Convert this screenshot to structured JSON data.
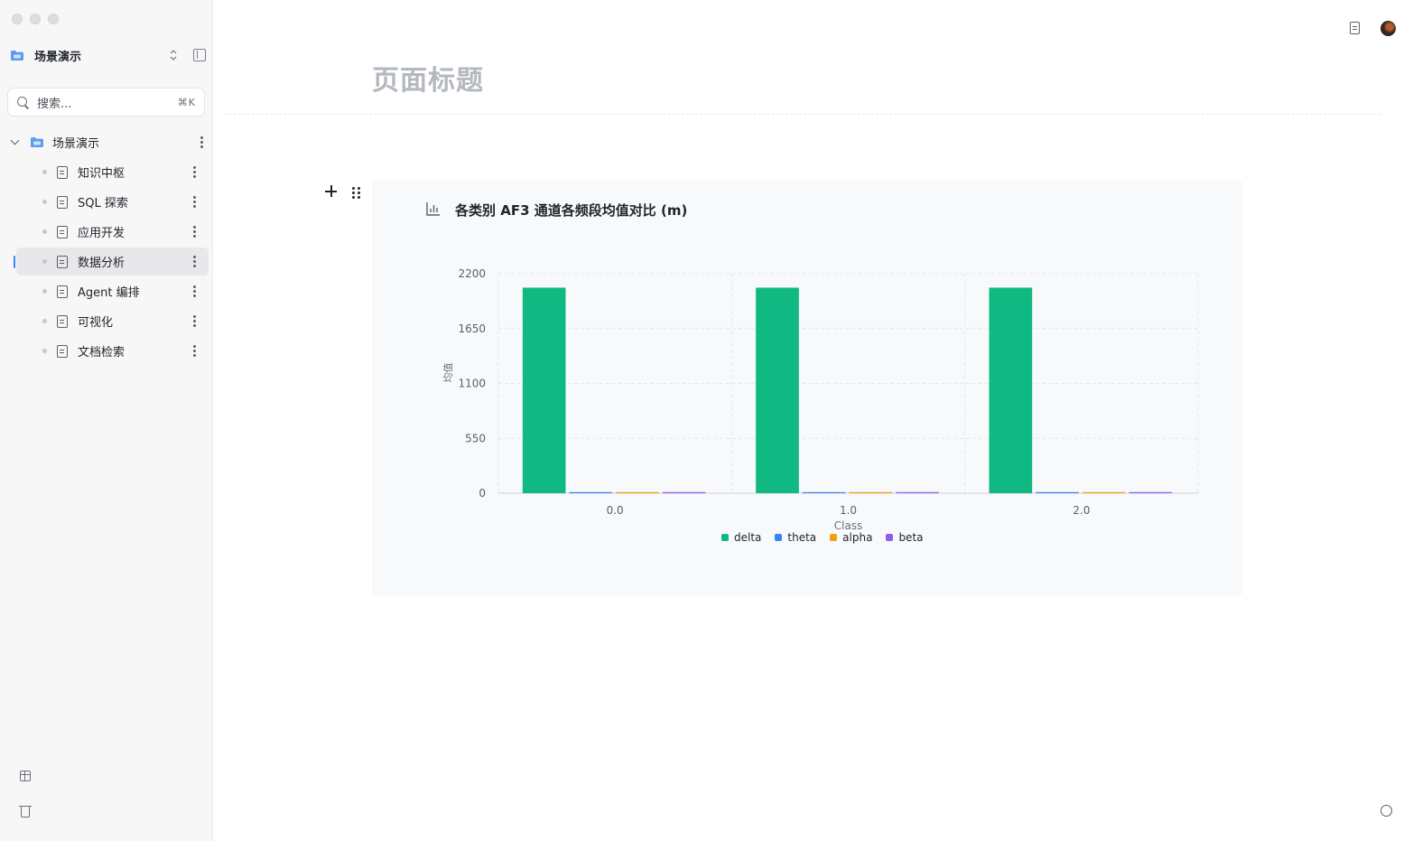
{
  "sidebar": {
    "workspace_title": "场景演示",
    "search": {
      "placeholder": "搜索...",
      "shortcut": "⌘K"
    },
    "tree_root": {
      "label": "场景演示"
    },
    "items": [
      {
        "label": "知识中枢",
        "active": false
      },
      {
        "label": "SQL 探索",
        "active": false
      },
      {
        "label": "应用开发",
        "active": false
      },
      {
        "label": "数据分析",
        "active": true
      },
      {
        "label": "Agent 编排",
        "active": false
      },
      {
        "label": "可视化",
        "active": false
      },
      {
        "label": "文档检索",
        "active": false
      }
    ]
  },
  "page": {
    "title": "页面标题"
  },
  "chart_block": {
    "title": "各类别 AF3 通道各频段均值对比 (m)"
  },
  "chart_data": {
    "type": "bar",
    "title": "各类别 AF3 通道各频段均值对比 (m)",
    "xlabel": "Class",
    "ylabel": "均值",
    "categories": [
      "0.0",
      "1.0",
      "2.0"
    ],
    "yticks": [
      "0",
      "550",
      "1100",
      "1650",
      "2200"
    ],
    "ylim": [
      0,
      2200
    ],
    "grid": true,
    "legend_position": "bottom",
    "series": [
      {
        "name": "delta",
        "color": "#10b981",
        "values": [
          2060,
          2060,
          2060
        ]
      },
      {
        "name": "theta",
        "color": "#3b82f6",
        "values": [
          4,
          4,
          4
        ]
      },
      {
        "name": "alpha",
        "color": "#f59e0b",
        "values": [
          3,
          3,
          3
        ]
      },
      {
        "name": "beta",
        "color": "#8b5cf6",
        "values": [
          4,
          4,
          4
        ]
      }
    ]
  }
}
